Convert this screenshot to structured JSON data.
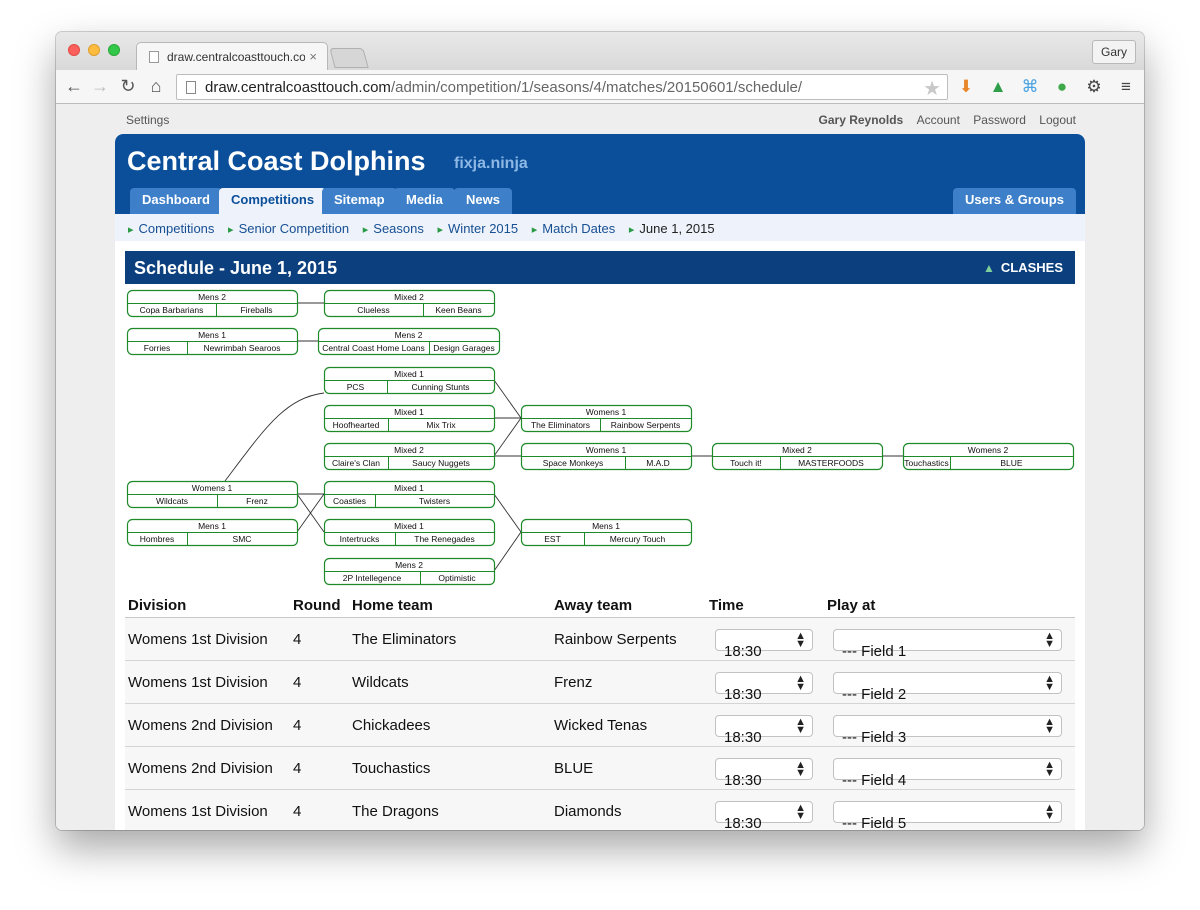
{
  "browser": {
    "tab_title": "draw.centralcoasttouch.co",
    "tab_close": "×",
    "profile_name": "Gary",
    "url_host": "draw.centralcoasttouch.com",
    "url_path": "/admin/competition/1/seasons/4/matches/20150601/schedule/",
    "extensions": [
      "download-icon",
      "drive-icon",
      "extension-icon",
      "evernote-icon",
      "gear-icon",
      "menu-icon"
    ]
  },
  "topbar": {
    "settings": "Settings",
    "user": "Gary Reynolds",
    "account": "Account",
    "password": "Password",
    "logout": "Logout"
  },
  "site": {
    "name": "Central Coast Dolphins",
    "subtitle": "fixja.ninja"
  },
  "nav": {
    "tabs": [
      "Dashboard",
      "Competitions",
      "Sitemap",
      "Media",
      "News"
    ],
    "active": "Competitions",
    "right_tab": "Users & Groups"
  },
  "breadcrumbs": [
    "Competitions",
    "Senior Competition",
    "Seasons",
    "Winter 2015",
    "Match Dates",
    "June 1, 2015"
  ],
  "schedule": {
    "title": "Schedule - June 1, 2015",
    "clashes_label": "CLASHES"
  },
  "diagram": {
    "colors": {
      "border": "#1e8a2a",
      "line": "#333333"
    },
    "matches": [
      {
        "division": "Mens 2",
        "home": "Copa Barbarians",
        "away": "Fireballs"
      },
      {
        "division": "Mixed 2",
        "home": "Clueless",
        "away": "Keen Beans"
      },
      {
        "division": "Mens 1",
        "home": "Forries",
        "away": "Newrimbah Searoos"
      },
      {
        "division": "Mens 2",
        "home": "Central Coast Home Loans",
        "away": "Design Garages"
      },
      {
        "division": "Mixed 1",
        "home": "PCS",
        "away": "Cunning Stunts"
      },
      {
        "division": "Mixed 1",
        "home": "Hoofhearted",
        "away": "Mix Trix"
      },
      {
        "division": "Womens 1",
        "home": "The Eliminators",
        "away": "Rainbow Serpents"
      },
      {
        "division": "Mixed 2",
        "home": "Claire's Clan",
        "away": "Saucy Nuggets"
      },
      {
        "division": "Womens 1",
        "home": "Space Monkeys",
        "away": "M.A.D"
      },
      {
        "division": "Mixed 2",
        "home": "Touch it!",
        "away": "MASTERFOODS"
      },
      {
        "division": "Womens 2",
        "home": "Touchastics",
        "away": "BLUE"
      },
      {
        "division": "Womens 1",
        "home": "Wildcats",
        "away": "Frenz"
      },
      {
        "division": "Mixed 1",
        "home": "Coasties",
        "away": "Twisters"
      },
      {
        "division": "Mens 1",
        "home": "Hombres",
        "away": "SMC"
      },
      {
        "division": "Mixed 1",
        "home": "Intertrucks",
        "away": "The Renegades"
      },
      {
        "division": "Mens 1",
        "home": "EST",
        "away": "Mercury Touch"
      },
      {
        "division": "Mens 2",
        "home": "2P Intellegence",
        "away": "Optimistic"
      }
    ]
  },
  "table": {
    "headers": [
      "Division",
      "Round",
      "Home team",
      "Away team",
      "Time",
      "Play at"
    ],
    "rows": [
      {
        "division": "Womens 1st Division",
        "round": "4",
        "home": "The Eliminators",
        "away": "Rainbow Serpents",
        "time": "18:30",
        "field": "--- Field 1"
      },
      {
        "division": "Womens 1st Division",
        "round": "4",
        "home": "Wildcats",
        "away": "Frenz",
        "time": "18:30",
        "field": "--- Field 2"
      },
      {
        "division": "Womens 2nd Division",
        "round": "4",
        "home": "Chickadees",
        "away": "Wicked Tenas",
        "time": "18:30",
        "field": "--- Field 3"
      },
      {
        "division": "Womens 2nd Division",
        "round": "4",
        "home": "Touchastics",
        "away": "BLUE",
        "time": "18:30",
        "field": "--- Field 4"
      },
      {
        "division": "Womens 1st Division",
        "round": "4",
        "home": "The Dragons",
        "away": "Diamonds",
        "time": "18:30",
        "field": "--- Field 5"
      }
    ]
  }
}
